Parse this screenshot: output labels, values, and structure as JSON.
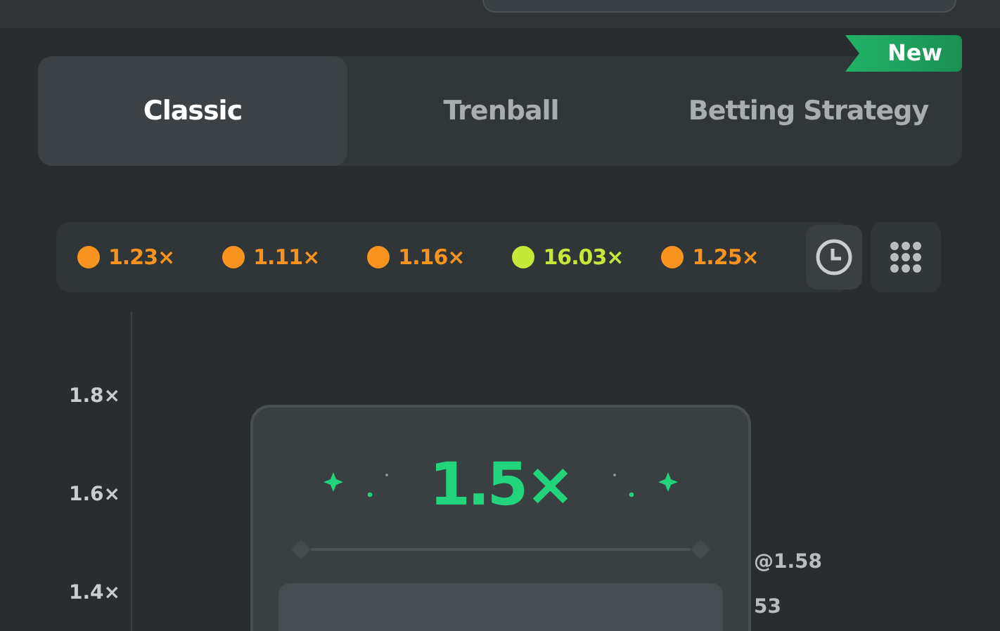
{
  "tabs": [
    {
      "label": "Classic",
      "selected": true
    },
    {
      "label": "Trenball",
      "selected": false
    },
    {
      "label": "Betting Strategy",
      "selected": false,
      "badge": "New"
    }
  ],
  "history": [
    {
      "value": "1.23×",
      "color": "#f7931e"
    },
    {
      "value": "1.11×",
      "color": "#f7931e"
    },
    {
      "value": "1.16×",
      "color": "#f7931e"
    },
    {
      "value": "16.03×",
      "color": "#c6e83b"
    },
    {
      "value": "1.25×",
      "color": "#f7931e"
    }
  ],
  "y_axis_labels": [
    "1.8×",
    "1.6×",
    "1.4×"
  ],
  "result_card": {
    "multiplier": "1.5×"
  },
  "side_labels": [
    "@1.58",
    "53"
  ]
}
